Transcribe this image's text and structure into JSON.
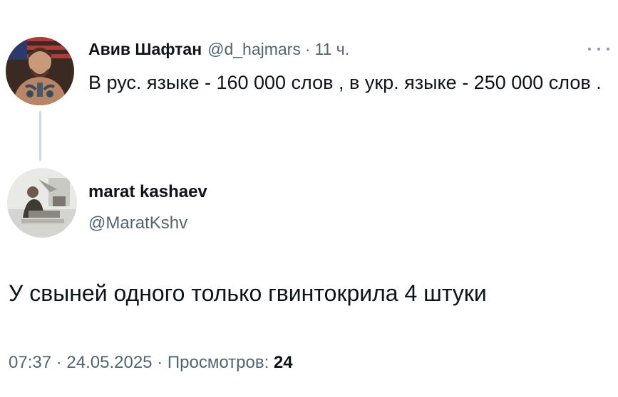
{
  "parent_tweet": {
    "display_name": "Авив Шафтан",
    "handle": "@d_hajmars",
    "separator": "·",
    "time": "11 ч.",
    "text": "В рус. языке - 160 000 слов , в укр. языке - 250 000 слов ."
  },
  "reply_tweet": {
    "display_name": "marat kashaev",
    "handle": "@MaratKshv",
    "text": "У свыней одного только гвинтокрила 4 штуки",
    "time": "07:37",
    "separator_1": "·",
    "date": "24.05.2025",
    "separator_2": "·",
    "views_label": "Просмотров:",
    "views_count": "24"
  },
  "icons": {
    "more": "more-horizontal-icon"
  },
  "colors": {
    "text_primary": "#0f1419",
    "text_secondary": "#536471",
    "thread_line": "#cfd9de",
    "background": "#ffffff"
  }
}
